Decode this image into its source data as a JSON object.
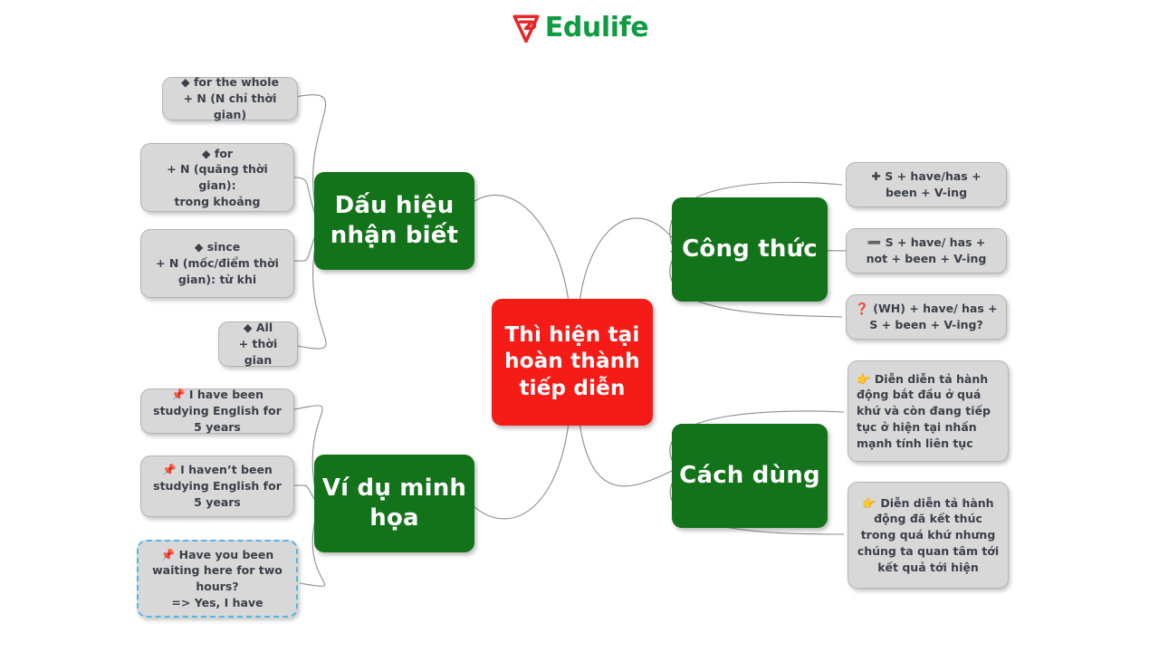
{
  "header": {
    "brand_name": "Edulife",
    "logo_icon": "edulife-triangle-logo",
    "brand_color": "#0f9b43",
    "logo_mark_color": "#e8252a"
  },
  "colors": {
    "root": "#f51b17",
    "branch": "#13731a",
    "leaf": "#d8d8d8",
    "leaf_border": "#b4b4b4",
    "leaf_text": "#3a3f4a",
    "connector": "#8c8c8c",
    "selection": "#56b6e0"
  },
  "mindmap": {
    "root": {
      "label": "Thì hiện tại hoàn thành tiếp diễn"
    },
    "branches": [
      {
        "id": "dau-hieu",
        "label": "Dấu hiệu nhận biết"
      },
      {
        "id": "vi-du",
        "label": "Ví dụ minh họa"
      },
      {
        "id": "cong-thuc",
        "label": "Công thức"
      },
      {
        "id": "cach-dung",
        "label": "Cách dùng"
      }
    ],
    "leaves": [
      {
        "id": "for-the-whole",
        "icon": "red-diamond",
        "glyph": "◆",
        "text": "for the whole\n+ N (N chỉ thời gian)"
      },
      {
        "id": "for",
        "icon": "red-diamond",
        "glyph": "◆",
        "text": "for\n+ N (quãng thời gian):\ntrong khoảng"
      },
      {
        "id": "since",
        "icon": "red-diamond",
        "glyph": "◆",
        "text": "since\n+ N (mốc/điểm thời gian): từ khi"
      },
      {
        "id": "all",
        "icon": "red-diamond",
        "glyph": "◆",
        "text": "All\n+ thời gian"
      },
      {
        "id": "example-affirmative",
        "icon": "pushpin",
        "glyph": "📌",
        "text": "I have been studying English for 5 years"
      },
      {
        "id": "example-negative",
        "icon": "pushpin",
        "glyph": "📌",
        "text": "I haven’t been studying English for 5 years"
      },
      {
        "id": "example-question",
        "icon": "pushpin",
        "glyph": "📌",
        "text": "Have you been waiting here for two hours?\n=> Yes, I have"
      },
      {
        "id": "formula-affirmative",
        "icon": "plus-sign",
        "glyph": "✚",
        "text": "S + have/has + been + V-ing"
      },
      {
        "id": "formula-negative",
        "icon": "minus-sign",
        "glyph": "➖",
        "text": "S + have/ has + not + been + V-ing"
      },
      {
        "id": "formula-question",
        "icon": "question-mark",
        "glyph": "❓",
        "text": "(WH) + have/ has + S + been + V-ing?"
      },
      {
        "id": "usage-continuing",
        "icon": "pointing-hand",
        "glyph": "👉",
        "text": "Diễn diễn tả hành động bắt đầu ở quá khứ và còn đang tiếp tục ở hiện tại nhấn mạnh tính liên tục"
      },
      {
        "id": "usage-result",
        "icon": "pointing-hand",
        "glyph": "👉",
        "text": "Diễn diễn tả hành động đã kết thúc trong quá khứ nhưng chúng ta quan tâm tới kết quả tới hiện"
      }
    ]
  }
}
